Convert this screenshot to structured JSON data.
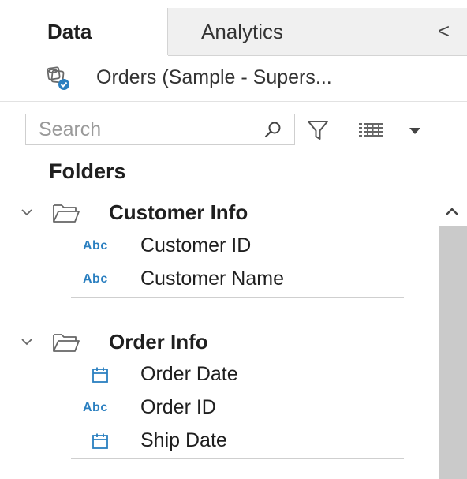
{
  "tabs": {
    "data_label": "Data",
    "analytics_label": "Analytics",
    "collapse_label": "<"
  },
  "datasource": {
    "label": "Orders (Sample - Supers..."
  },
  "search": {
    "placeholder": "Search",
    "value": ""
  },
  "folders": {
    "heading": "Folders",
    "groups": [
      {
        "label": "Customer Info",
        "fields": [
          {
            "type": "Abc",
            "label": "Customer ID"
          },
          {
            "type": "Abc",
            "label": "Customer Name"
          }
        ]
      },
      {
        "label": "Order Info",
        "fields": [
          {
            "type": "date",
            "label": "Order Date"
          },
          {
            "type": "Abc",
            "label": "Order ID"
          },
          {
            "type": "date",
            "label": "Ship Date"
          }
        ]
      }
    ]
  },
  "icons": {
    "datasource": "datasource-icon",
    "search": "search-icon",
    "filter": "filter-icon",
    "list": "list-view-icon",
    "dropdown": "chevron-down-icon",
    "folder": "folder-open-icon",
    "date": "calendar-icon",
    "scroll_up": "chevron-up-icon"
  },
  "colors": {
    "string_type": "#2a7fc0",
    "date_type": "#2a7fc0",
    "scroll_thumb": "#cacaca",
    "inactive_tab": "#f0f0f0"
  }
}
